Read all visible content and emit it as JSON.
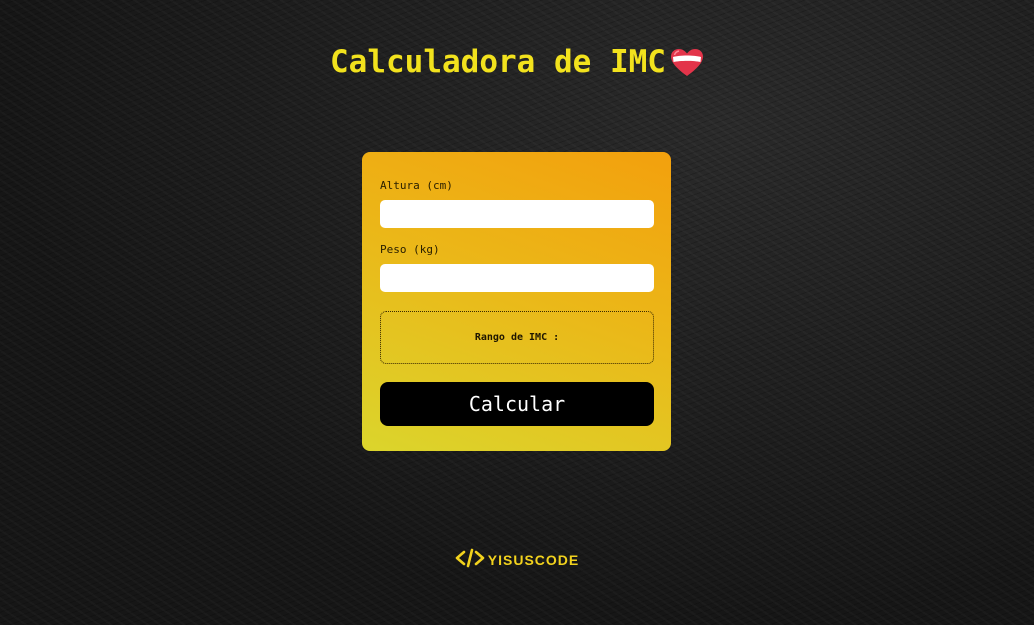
{
  "header": {
    "title": "Calculadora de IMC",
    "icon": "heart-icon"
  },
  "form": {
    "height_label": "Altura (cm)",
    "height_value": "",
    "weight_label": "Peso (kg)",
    "weight_value": "",
    "result_label": "Rango de IMC :",
    "result_value": "",
    "submit_label": "Calcular"
  },
  "footer": {
    "brand": "YISUSCODE",
    "icon": "code-icon"
  },
  "colors": {
    "title": "#f2e21d",
    "card_top": "#f3a00d",
    "card_bottom": "#dbd52c",
    "button": "#000000",
    "background": "#1b1b1b"
  }
}
